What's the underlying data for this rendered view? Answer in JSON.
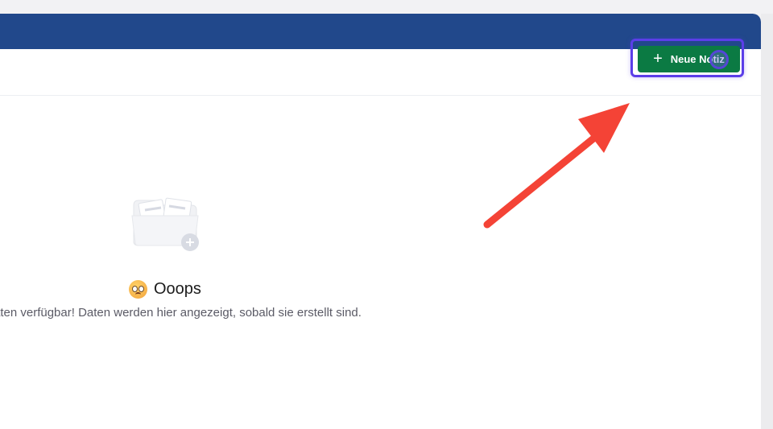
{
  "toolbar": {
    "new_note_label": "Neue Notiz",
    "new_note_icon": "plus-icon"
  },
  "empty_state": {
    "title": "Ooops",
    "emoji": "worried-face-emoji",
    "message": "aten verfügbar! Daten werden hier angezeigt, sobald sie erstellt sind.",
    "illustration": "empty-folder-icon"
  },
  "colors": {
    "header_bar": "#21488b",
    "primary_button": "#0b7a43",
    "highlight": "#5b3ee8",
    "arrow": "#f44336"
  }
}
